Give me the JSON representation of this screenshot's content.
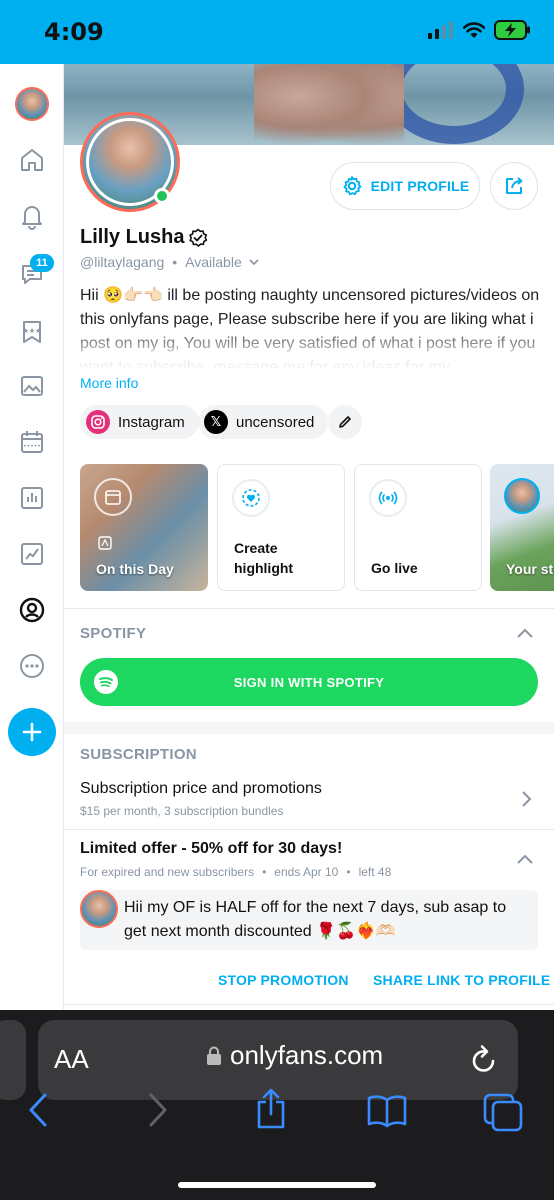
{
  "status_bar": {
    "time": "4:09"
  },
  "sidebar": {
    "messages_badge": "11"
  },
  "profile": {
    "name": "Lilly Lusha",
    "handle": "@liltaylagang",
    "availability": "Available",
    "bio": "Hii 🥺👉🏻👈🏻 ill be posting naughty uncensored pictures/videos on this onlyfans page, Please subscribe here if you are liking what i post on my ig, You will be very satisfied of what i post here if you want to subscribe, message me for any ideas for my",
    "more_info": "More info",
    "edit_profile_label": "EDIT PROFILE"
  },
  "links": [
    {
      "label": "Instagram"
    },
    {
      "label": "uncensored"
    }
  ],
  "highlights": [
    {
      "label": "On this Day"
    },
    {
      "label": "Create highlight"
    },
    {
      "label": "Go live"
    },
    {
      "label": "Your story"
    }
  ],
  "spotify": {
    "section_title": "SPOTIFY",
    "button_label": "SIGN IN WITH SPOTIFY"
  },
  "subscription": {
    "section_title": "SUBSCRIPTION",
    "price_title": "Subscription price and promotions",
    "price_sub": "$15 per month, 3 subscription bundles"
  },
  "offer": {
    "title": "Limited offer - 50% off for 30 days!",
    "audience": "For expired and new subscribers",
    "ends": "ends Apr 10",
    "left": "left 48",
    "message": "Hii my OF is HALF off for the next 7 days, sub asap to get next month discounted 🌹🍒❤️‍🔥🫶🏻",
    "stop_label": "STOP PROMOTION",
    "share_label": "SHARE LINK TO PROFILE"
  },
  "browser": {
    "aa_label": "AA",
    "url": "onlyfans.com"
  },
  "colors": {
    "accent": "#00aff0",
    "spotify": "#1ed760",
    "online": "#21c45b",
    "avatar_ring": "#ff6b55"
  }
}
